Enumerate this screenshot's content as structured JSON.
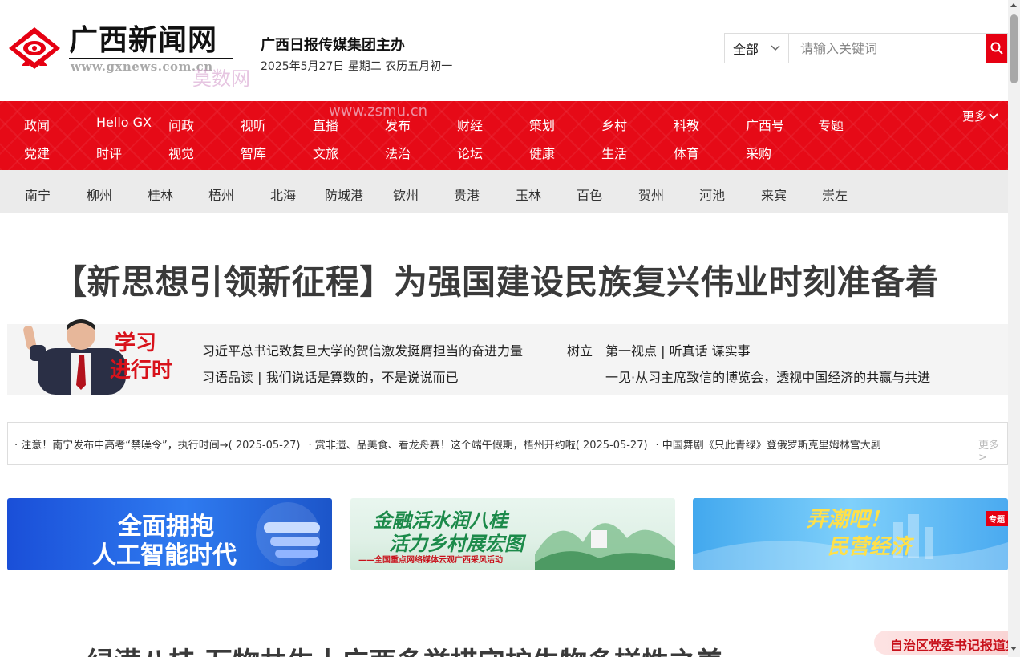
{
  "header": {
    "logo_title": "广西新闻网",
    "logo_url": "www.gxnews.com.cn",
    "publisher": "广西日报传媒集团主办",
    "date_line": "2025年5月27日 星期二 农历五月初一",
    "watermark": "莫数网",
    "watermark_url": "www.zsmu.cn"
  },
  "search": {
    "scope_label": "全部",
    "placeholder": "请输入关键词",
    "icon": "search-icon"
  },
  "nav": {
    "row1": [
      "政闻",
      "Hello GX",
      "问政",
      "视听",
      "直播",
      "发布",
      "财经",
      "策划",
      "乡村",
      "科教",
      "广西号",
      "专题"
    ],
    "row2": [
      "党建",
      "时评",
      "视觉",
      "智库",
      "文旅",
      "法治",
      "论坛",
      "健康",
      "生活",
      "体育",
      "采购"
    ],
    "more_label": "更多"
  },
  "cities": [
    "南宁",
    "柳州",
    "桂林",
    "梧州",
    "北海",
    "防城港",
    "钦州",
    "贵港",
    "玉林",
    "百色",
    "贺州",
    "河池",
    "来宾",
    "崇左"
  ],
  "headline": "【新思想引领新征程】为强国建设民族复兴伟业时刻准备着",
  "study": {
    "badge_line1": "学习",
    "badge_line2": "进行时",
    "link1": "习近平总书记致复旦大学的贺信激发挺膺担当的奋进力量",
    "link2": "树立",
    "link3": "第一视点 | 听真话 谋实事",
    "link4": "习语品读 | 我们说话是算数的，不是说说而已",
    "link5": "一见·从习主席致信的博览会，透视中国经济的共赢与共进"
  },
  "ticker": {
    "items": [
      "· 注意！南宁发布中高考“禁噪令”，执行时间→( 2025-05-27)",
      "· 赏非遗、品美食、看龙舟赛！这个端午假期，梧州开约啦( 2025-05-27)",
      "· 中国舞剧《只此青绿》登俄罗斯克里姆林宫大剧"
    ],
    "more_label": "更多 >"
  },
  "banners": {
    "b1_line1": "全面拥抱",
    "b1_line2": "人工智能时代",
    "b2_line1": "金融活水润八桂",
    "b2_line2": "活力乡村展宏图",
    "b2_sub": "——全国重点网络媒体云观广西采风活动",
    "b3_line1": "弄潮吧！",
    "b3_line2": "民营经济",
    "b3_tag": "专题"
  },
  "bottom": {
    "headline": "绿满八桂 万物共生丨广西多举措守护生物多样性之美",
    "badge": "自治区党委书记报道集"
  },
  "colors": {
    "brand_red": "#e60a17",
    "city_bar": "#ebebeb",
    "headline_text": "#3a3a3a"
  }
}
